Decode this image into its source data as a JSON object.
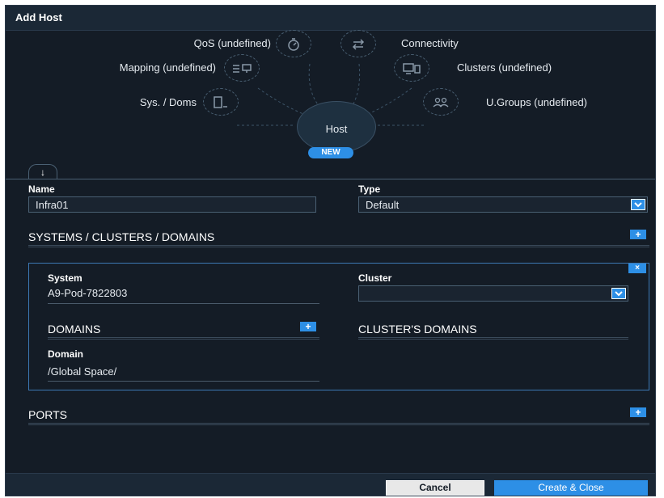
{
  "dialog": {
    "title": "Add Host"
  },
  "hub": {
    "center_label": "Host",
    "badge": "NEW",
    "nodes": {
      "qos": {
        "label": "QoS (undefined)",
        "icon": "stopwatch-icon"
      },
      "connectivity": {
        "label": "Connectivity",
        "icon": "swap-arrows-icon"
      },
      "mapping": {
        "label": "Mapping (undefined)",
        "icon": "mapping-icon"
      },
      "clusters": {
        "label": "Clusters (undefined)",
        "icon": "monitor-icon"
      },
      "sysdoms": {
        "label": "Sys. / Doms",
        "icon": "server-icon"
      },
      "ugroups": {
        "label": "U.Groups (undefined)",
        "icon": "users-icon"
      }
    }
  },
  "tab": {
    "arrow": "↓"
  },
  "form": {
    "name_label": "Name",
    "name_value": "Infra01",
    "type_label": "Type",
    "type_value": "Default"
  },
  "systems_section": {
    "title": "SYSTEMS / CLUSTERS / DOMAINS",
    "add": "+",
    "remove": "×",
    "system_label": "System",
    "system_value": "A9-Pod-7822803",
    "cluster_label": "Cluster",
    "cluster_value": "",
    "domains_title": "DOMAINS",
    "domains_add": "+",
    "cluster_domains_title": "CLUSTER'S DOMAINS",
    "domain_label": "Domain",
    "domain_value": "/Global Space/"
  },
  "ports_section": {
    "title": "PORTS",
    "add": "+"
  },
  "footer": {
    "cancel": "Cancel",
    "create": "Create & Close"
  },
  "colors": {
    "background": "#141c26",
    "accent": "#2d8fe6",
    "panel_border": "#3c78b4"
  }
}
